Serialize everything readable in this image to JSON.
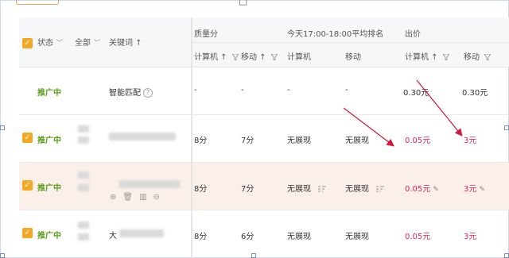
{
  "header": {
    "status_label": "状态",
    "all_label": "全部",
    "keyword_label": "关键词 ↑",
    "quality_group": "质量分",
    "rank_group": "今天17:00-18:00平均排名",
    "bid_group": "出价",
    "sub_headers": [
      "计算机 ↑",
      "移动 ↑",
      "计算机",
      "移动",
      "计算机 ↑",
      "移动"
    ],
    "top_glyph": "□"
  },
  "rows": [
    {
      "status": "推广中",
      "keyword": "智能匹配",
      "quality_pc": "-",
      "quality_mobile": "-",
      "rank_pc": "-",
      "rank_mobile": "-",
      "bid_pc": "0.30元",
      "bid_mobile": "0.30元",
      "checked": false
    },
    {
      "status": "推广中",
      "keyword": "",
      "quality_pc": "8分",
      "quality_mobile": "7分",
      "rank_pc": "无展现",
      "rank_mobile": "无展现",
      "bid_pc": "0.05元",
      "bid_mobile": "3元",
      "checked": true
    },
    {
      "status": "推广中",
      "keyword": "",
      "quality_pc": "8分",
      "quality_mobile": "7分",
      "rank_pc": "无展现",
      "rank_mobile": "无展现",
      "bid_pc": "0.05元",
      "bid_mobile": "3元",
      "checked": true
    },
    {
      "status": "推广中",
      "keyword": "大",
      "quality_pc": "8分",
      "quality_mobile": "6分",
      "rank_pc": "无展现",
      "rank_mobile": "无展现",
      "bid_pc": "0.05元",
      "bid_mobile": "3元",
      "checked": true
    }
  ],
  "row_tools": [
    "⊕",
    "🗑",
    "▥",
    "⊖"
  ],
  "colors": {
    "accent": "#f5a623",
    "status_green": "#5a9e1a",
    "price_red": "#e0285a",
    "arrow_red": "#d4173c"
  }
}
